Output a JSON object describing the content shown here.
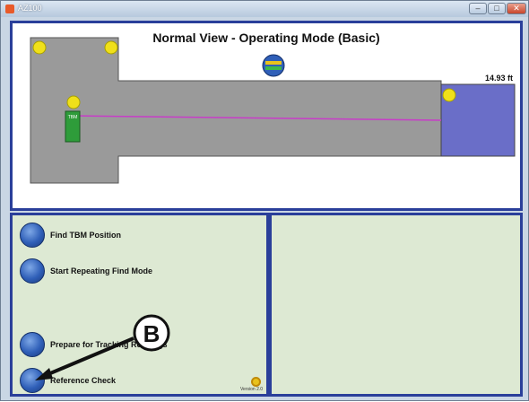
{
  "window": {
    "title": "AZ100"
  },
  "view": {
    "title": "Normal View - Operating Mode (Basic)",
    "scale_label": "14.93 ft",
    "tbm_label": "TBM"
  },
  "menu": {
    "items": [
      {
        "label": "Find TBM Position",
        "icon": "find-icon"
      },
      {
        "label": "Start Repeating Find Mode",
        "icon": "find-icon"
      },
      {
        "label": "Prepare for Tracking Readings",
        "icon": "bore-path-icon"
      },
      {
        "label": "Reference Check",
        "icon": "reference-check-icon"
      }
    ],
    "version": "Version 2.0"
  },
  "callout": {
    "letter": "B"
  },
  "colors": {
    "panel_border": "#2a3f9a",
    "bore_area": "#9a9a9a",
    "target_area": "#6a6ec8",
    "marker": "#f0e01a",
    "tbm": "#2e9c3a",
    "path": "#c83cc8"
  }
}
